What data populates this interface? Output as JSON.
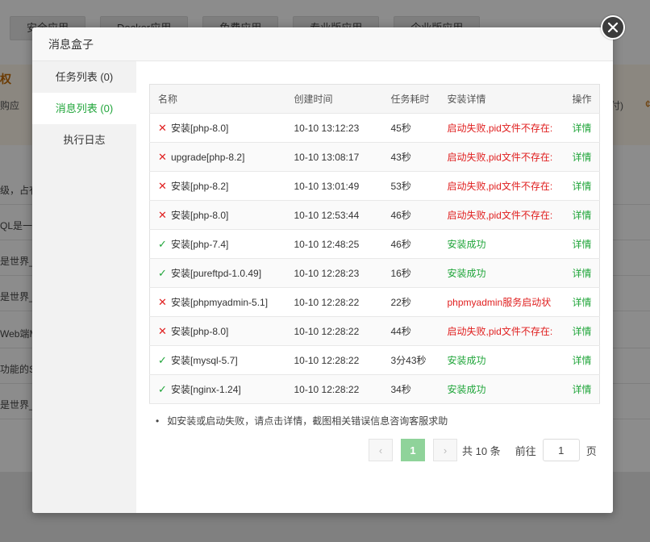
{
  "background": {
    "tabs": [
      "安全应用",
      "Docker应用",
      "免费应用",
      "专业版应用",
      "企业版应用"
    ],
    "heading": "权",
    "subtext": "购应",
    "subtext_right": "付)",
    "subtext_right2": "¢",
    "rows": [
      "级，占有",
      "QL是一",
      "是世界_",
      "是世界_",
      "Web端M",
      "功能的S",
      "是世界_"
    ]
  },
  "dialog": {
    "title": "消息盒子",
    "close_icon": "close-icon"
  },
  "sidebar": {
    "items": [
      {
        "label": "任务列表 (0)"
      },
      {
        "label": "消息列表 (0)"
      },
      {
        "label": "执行日志"
      }
    ]
  },
  "table": {
    "headers": {
      "name": "名称",
      "created": "创建时间",
      "duration": "任务耗时",
      "detail": "安装详情",
      "op": "操作"
    },
    "rows": [
      {
        "status": "fail",
        "icon": "✕",
        "name": "安装[php-8.0]",
        "created": "10-10 13:12:23",
        "duration": "45秒",
        "detail": "启动失败,pid文件不存在:",
        "op": "详情"
      },
      {
        "status": "fail",
        "icon": "✕",
        "name": "upgrade[php-8.2]",
        "created": "10-10 13:08:17",
        "duration": "43秒",
        "detail": "启动失败,pid文件不存在:",
        "op": "详情"
      },
      {
        "status": "fail",
        "icon": "✕",
        "name": "安装[php-8.2]",
        "created": "10-10 13:01:49",
        "duration": "53秒",
        "detail": "启动失败,pid文件不存在:",
        "op": "详情"
      },
      {
        "status": "fail",
        "icon": "✕",
        "name": "安装[php-8.0]",
        "created": "10-10 12:53:44",
        "duration": "46秒",
        "detail": "启动失败,pid文件不存在:",
        "op": "详情"
      },
      {
        "status": "ok",
        "icon": "✓",
        "name": "安装[php-7.4]",
        "created": "10-10 12:48:25",
        "duration": "46秒",
        "detail": "安装成功",
        "op": "详情"
      },
      {
        "status": "ok",
        "icon": "✓",
        "name": "安装[pureftpd-1.0.49]",
        "created": "10-10 12:28:23",
        "duration": "16秒",
        "detail": "安装成功",
        "op": "详情"
      },
      {
        "status": "fail",
        "icon": "✕",
        "name": "安装[phpmyadmin-5.1]",
        "created": "10-10 12:28:22",
        "duration": "22秒",
        "detail": "phpmyadmin服务启动状",
        "op": "详情"
      },
      {
        "status": "fail",
        "icon": "✕",
        "name": "安装[php-8.0]",
        "created": "10-10 12:28:22",
        "duration": "44秒",
        "detail": "启动失败,pid文件不存在:",
        "op": "详情"
      },
      {
        "status": "ok",
        "icon": "✓",
        "name": "安装[mysql-5.7]",
        "created": "10-10 12:28:22",
        "duration": "3分43秒",
        "detail": "安装成功",
        "op": "详情"
      },
      {
        "status": "ok",
        "icon": "✓",
        "name": "安装[nginx-1.24]",
        "created": "10-10 12:28:22",
        "duration": "34秒",
        "detail": "安装成功",
        "op": "详情"
      }
    ]
  },
  "tip": "如安装或启动失败，请点击详情，截图相关错误信息咨询客服求助",
  "pagination": {
    "prev": "‹",
    "current": "1",
    "next": "›",
    "total": "共 10 条",
    "goto_label": "前往",
    "goto_value": "1",
    "page_suffix": "页"
  },
  "colors": {
    "accent": "#20a53a",
    "error": "#e02020"
  }
}
